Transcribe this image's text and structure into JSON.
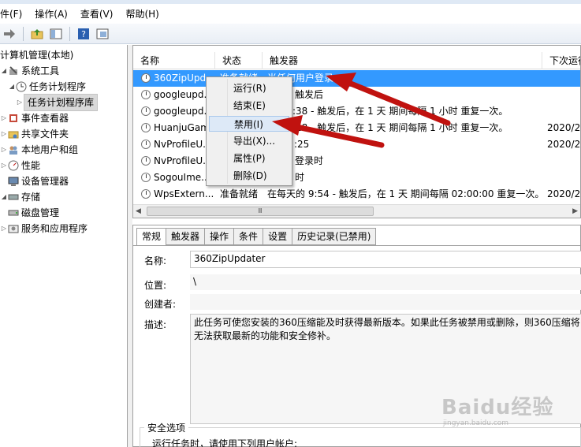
{
  "menu": [
    "件(F)",
    "操作(A)",
    "查看(V)",
    "帮助(H)"
  ],
  "toolbar_icons": [
    "back-arrow-icon",
    "forward-arrow-icon",
    "folder-up-icon",
    "console-tree-icon",
    "help-icon",
    "console-view-icon"
  ],
  "tree": {
    "root": "计算机管理(本地)",
    "items": [
      {
        "label": "系统工具",
        "icon": "tools-icon"
      },
      {
        "label": "任务计划程序",
        "icon": "clock-icon"
      },
      {
        "label": "任务计划程序库",
        "icon": "folder-icon"
      },
      {
        "label": "事件查看器",
        "icon": "event-icon"
      },
      {
        "label": "共享文件夹",
        "icon": "share-icon"
      },
      {
        "label": "本地用户和组",
        "icon": "users-icon"
      },
      {
        "label": "性能",
        "icon": "performance-icon"
      },
      {
        "label": "设备管理器",
        "icon": "device-icon"
      },
      {
        "label": "存储",
        "icon": "storage-icon"
      },
      {
        "label": "磁盘管理",
        "icon": "disk-icon"
      },
      {
        "label": "服务和应用程序",
        "icon": "services-icon"
      }
    ]
  },
  "list": {
    "columns": [
      "名称",
      "状态",
      "触发器",
      "下次运行"
    ],
    "rows": [
      {
        "name": "360ZipUpd...",
        "status": "准备就绪",
        "trigger": "当任何用户登录",
        "next": ""
      },
      {
        "name": "googleupd...",
        "status": "",
        "trigger": "触发后",
        "next": ""
      },
      {
        "name": "googleupd...",
        "status": "",
        "trigger": ":38 - 触发后，在 1 天 期间每隔 1 小时 重复一次。",
        "next": ""
      },
      {
        "name": "HuanjuGam",
        "status": "",
        "trigger": ":28 - 触发后，在 1 天 期间每隔 1 小时 重复一次。",
        "next": "2020/2/"
      },
      {
        "name": "NvProfileU...",
        "status": "",
        "trigger": ":25",
        "next": "2020/2/"
      },
      {
        "name": "NvProfileU...",
        "status": "",
        "trigger": "登录时",
        "next": ""
      },
      {
        "name": "SogouIme...",
        "status": "",
        "trigger": "时",
        "next": ""
      },
      {
        "name": "WpsExtern...",
        "status": "准备就绪",
        "trigger": "在每天的 9:54 - 触发后，在 1 天 期间每隔 02:00:00 重复一次。",
        "next": "2020/2/"
      }
    ],
    "scroll_thumb": "Ⅲ"
  },
  "context_menu": {
    "items": [
      "运行(R)",
      "结束(E)",
      "禁用(I)",
      "导出(X)...",
      "属性(P)",
      "删除(D)"
    ],
    "highlighted": "禁用(I)"
  },
  "detail": {
    "tabs": [
      "常规",
      "触发器",
      "操作",
      "条件",
      "设置",
      "历史记录(已禁用)"
    ],
    "name_label": "名称:",
    "name_value": "360ZipUpdater",
    "location_label": "位置:",
    "location_value": "\\",
    "author_label": "创建者:",
    "desc_label": "描述:",
    "desc_value": "此任务可使您安装的360压缩能及时获得最新版本。如果此任务被禁用或删除，则360压缩将无法获取最新的功能和安全修补。",
    "security_label": "安全选项",
    "security_run": "运行任务时，请使用下列用户帐户:"
  },
  "watermark": {
    "text": "Baidu经验",
    "sub": "jingyan.baidu.com"
  },
  "colors": {
    "selection": "#3399ff",
    "arrow": "#c0120f",
    "menu_highlight": "#dde9f7"
  }
}
